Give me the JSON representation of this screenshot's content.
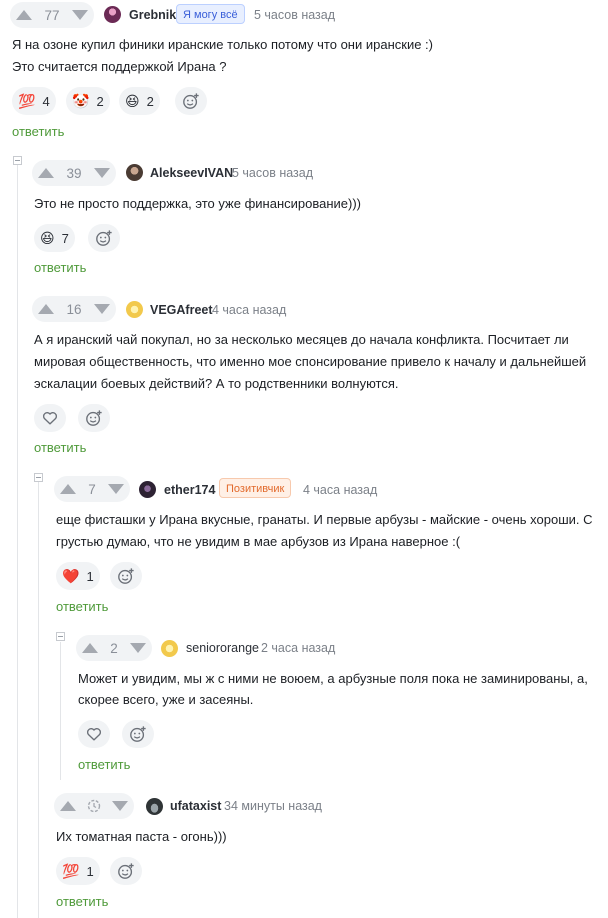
{
  "comments": [
    {
      "score": "77",
      "author": "Grebnik",
      "badge": "Я могу всё",
      "time": "5 часов назад",
      "text_lines": [
        "Я на озоне купил финики иранские только потому что они иранские :)",
        "Это считается поддержкой Ирана ?"
      ],
      "reactions": [
        {
          "emoji": "💯",
          "count": "4"
        },
        {
          "emoji": "🤡",
          "count": "2"
        },
        {
          "emoji": "😆",
          "count": "2"
        }
      ],
      "reply_label": "ответить"
    },
    {
      "score": "39",
      "author": "AlekseevIVAN",
      "time": "5 часов назад",
      "text_lines": [
        "Это не просто поддержка, это уже финансирование)))"
      ],
      "reactions": [
        {
          "emoji": "😆",
          "count": "7"
        }
      ],
      "reply_label": "ответить"
    },
    {
      "score": "16",
      "author": "VEGAfreet",
      "time": "4 часа назад",
      "text_lines": [
        "А я иранский чай покупал, но за несколько месяцев до начала конфликта. Посчитает ли",
        "мировая общественность, что именно мое спонсирование привело к началу и дальнейшей",
        "эскалации боевых действий? А то родственники волнуются."
      ],
      "reply_label": "ответить"
    },
    {
      "score": "7",
      "author": "ether174",
      "badge": "Позитивчик",
      "time": "4 часа назад",
      "text_lines": [
        "еще фисташки у Ирана вкусные, гранаты. И первые арбузы - майские - очень хороши. С",
        "грустью думаю, что не увидим в мае арбузов из Ирана наверное :("
      ],
      "reactions": [
        {
          "emoji": "❤️",
          "count": "1"
        }
      ],
      "reply_label": "ответить"
    },
    {
      "score": "2",
      "author": "seniororange",
      "time": "2 часа назад",
      "text_lines": [
        "Может и увидим, мы ж с ними не воюем, а арбузные поля пока не заминированы, а,",
        "скорее всего, уже и засеяны."
      ],
      "reply_label": "ответить"
    },
    {
      "score_icon": "clock-icon",
      "author": "ufataxist",
      "time": "34 минуты назад",
      "text_lines": [
        "Их томатная паста - огонь)))"
      ],
      "reactions": [
        {
          "emoji": "💯",
          "count": "1"
        }
      ],
      "reply_label": "ответить"
    }
  ],
  "colors": {
    "reply_link": "#4f9a3a",
    "badge_blue_bg": "#e8efff",
    "badge_blue_text": "#3a5fd9",
    "badge_orange_bg": "#fff0e6",
    "badge_orange_text": "#e26a2c"
  }
}
